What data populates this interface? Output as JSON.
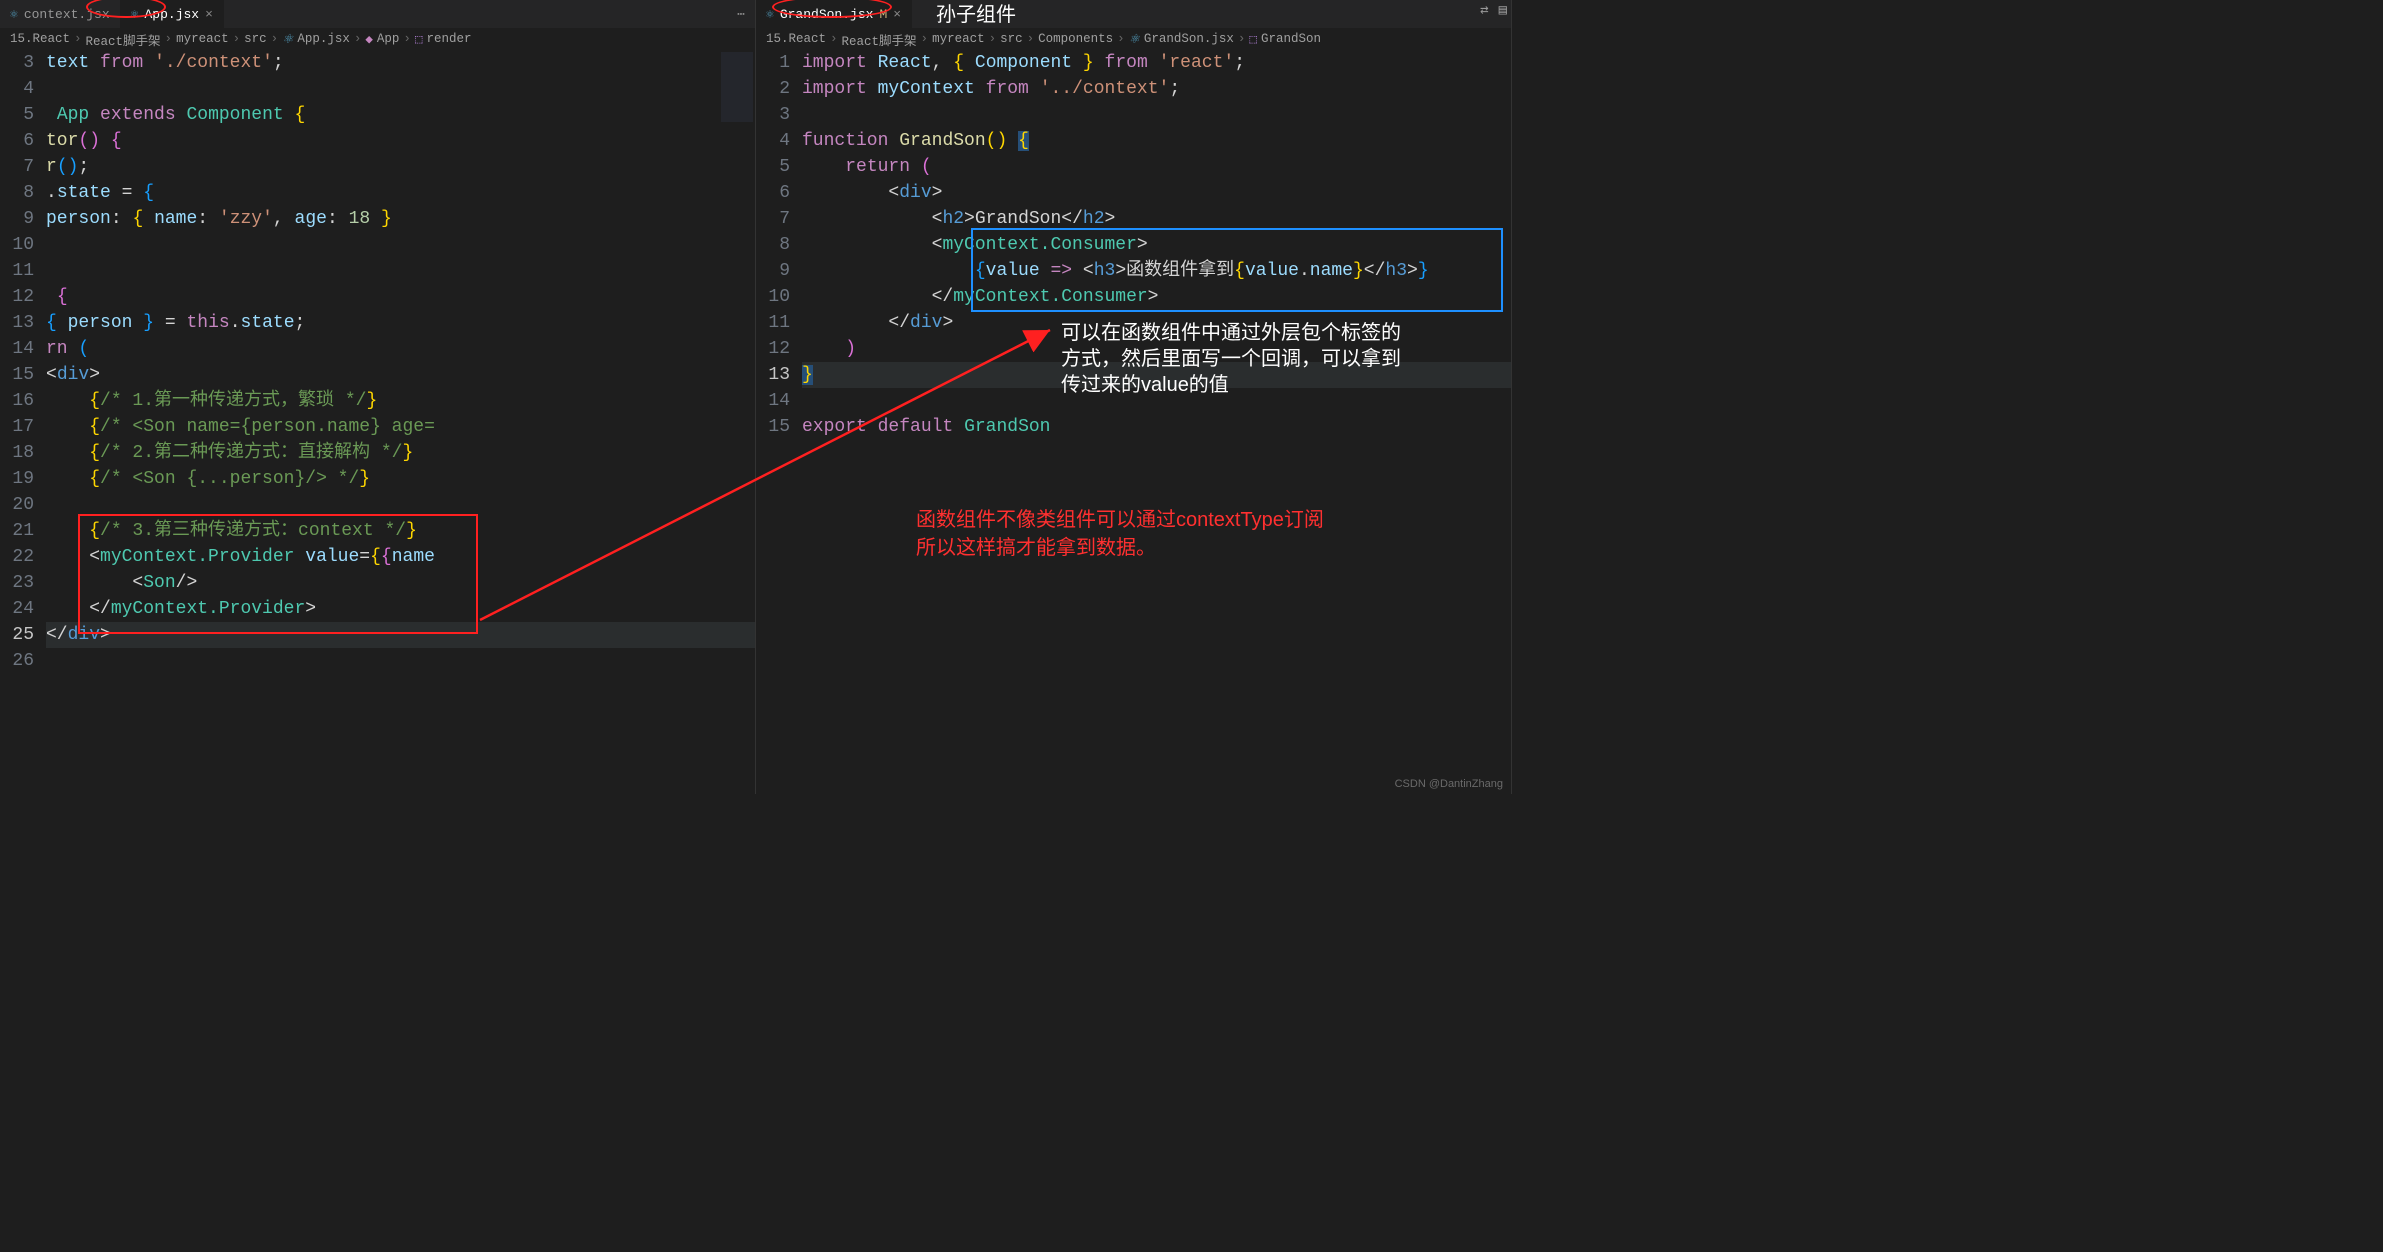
{
  "leftPane": {
    "tabs": [
      {
        "icon": "⚛",
        "label": "context.jsx",
        "active": false
      },
      {
        "icon": "⚛",
        "label": "App.jsx",
        "active": true,
        "close": "×"
      }
    ],
    "moreIcon": "⋯",
    "breadcrumbs": [
      "15.React",
      "React脚手架",
      "myreact",
      "src",
      "App.jsx",
      "App",
      "render"
    ],
    "lineStart": 3,
    "lines": [
      {
        "n": 3,
        "raw": "text from ./context ;"
      },
      {
        "n": 4,
        "raw": ""
      },
      {
        "n": 5,
        "raw": " App extends Component {"
      },
      {
        "n": 6,
        "raw": "tor() {"
      },
      {
        "n": 7,
        "raw": "r();"
      },
      {
        "n": 8,
        "raw": ".state = {"
      },
      {
        "n": 9,
        "raw": "person: { name: 'zzy', age: 18 }"
      },
      {
        "n": 10,
        "raw": ""
      },
      {
        "n": 11,
        "raw": ""
      },
      {
        "n": 12,
        "raw": " {"
      },
      {
        "n": 13,
        "raw": "{ person } = this.state;"
      },
      {
        "n": 14,
        "raw": "rn ("
      },
      {
        "n": 15,
        "raw": "<div>"
      },
      {
        "n": 16,
        "raw": "    {/* 1.第一种传递方式，繁琐 */}"
      },
      {
        "n": 17,
        "raw": "    {/* <Son name={person.name} age="
      },
      {
        "n": 18,
        "raw": "    {/* 2.第二种传递方式：直接解构 */}"
      },
      {
        "n": 19,
        "raw": "    {/* <Son {...person}/> */}"
      },
      {
        "n": 20,
        "raw": ""
      },
      {
        "n": 21,
        "raw": "    {/* 3.第三种传递方式：context */}"
      },
      {
        "n": 22,
        "raw": "    <myContext.Provider value={{name"
      },
      {
        "n": 23,
        "raw": "        <Son/>"
      },
      {
        "n": 24,
        "raw": "    </myContext.Provider>"
      },
      {
        "n": 25,
        "raw": "</div>"
      },
      {
        "n": 26,
        "raw": ""
      }
    ]
  },
  "rightPane": {
    "tabs": [
      {
        "icon": "⚛",
        "label": "GrandSon.jsx",
        "status": "M",
        "close": "×",
        "active": true
      }
    ],
    "titleAnnot": "孙子组件",
    "breadcrumbs": [
      "15.React",
      "React脚手架",
      "myreact",
      "src",
      "Components",
      "GrandSon.jsx",
      "GrandSon"
    ],
    "lines": [
      {
        "n": 1,
        "raw": "import React, { Component } from 'react';"
      },
      {
        "n": 2,
        "raw": "import myContext from '../context';"
      },
      {
        "n": 3,
        "raw": ""
      },
      {
        "n": 4,
        "raw": "function GrandSon() {"
      },
      {
        "n": 5,
        "raw": "    return ("
      },
      {
        "n": 6,
        "raw": "        <div>"
      },
      {
        "n": 7,
        "raw": "            <h2>GrandSon</h2>"
      },
      {
        "n": 8,
        "raw": "            <myContext.Consumer>"
      },
      {
        "n": 9,
        "raw": "                {value => <h3>函数组件拿到{value.name}</h3>}"
      },
      {
        "n": 10,
        "raw": "            </myContext.Consumer>"
      },
      {
        "n": 11,
        "raw": "        </div>"
      },
      {
        "n": 12,
        "raw": "    )"
      },
      {
        "n": 13,
        "raw": "}"
      },
      {
        "n": 14,
        "raw": ""
      },
      {
        "n": 15,
        "raw": "export default GrandSon"
      }
    ],
    "whiteAnnot": "可以在函数组件中通过外层包个标签的\n方式，然后里面写一个回调，可以拿到\n传过来的value的值",
    "redAnnot": "函数组件不像类组件可以通过contextType订阅\n所以这样搞才能拿到数据。"
  },
  "topRightIcons": {
    "a": "⇄",
    "b": "▤"
  },
  "watermark": "CSDN @DantinZhang"
}
